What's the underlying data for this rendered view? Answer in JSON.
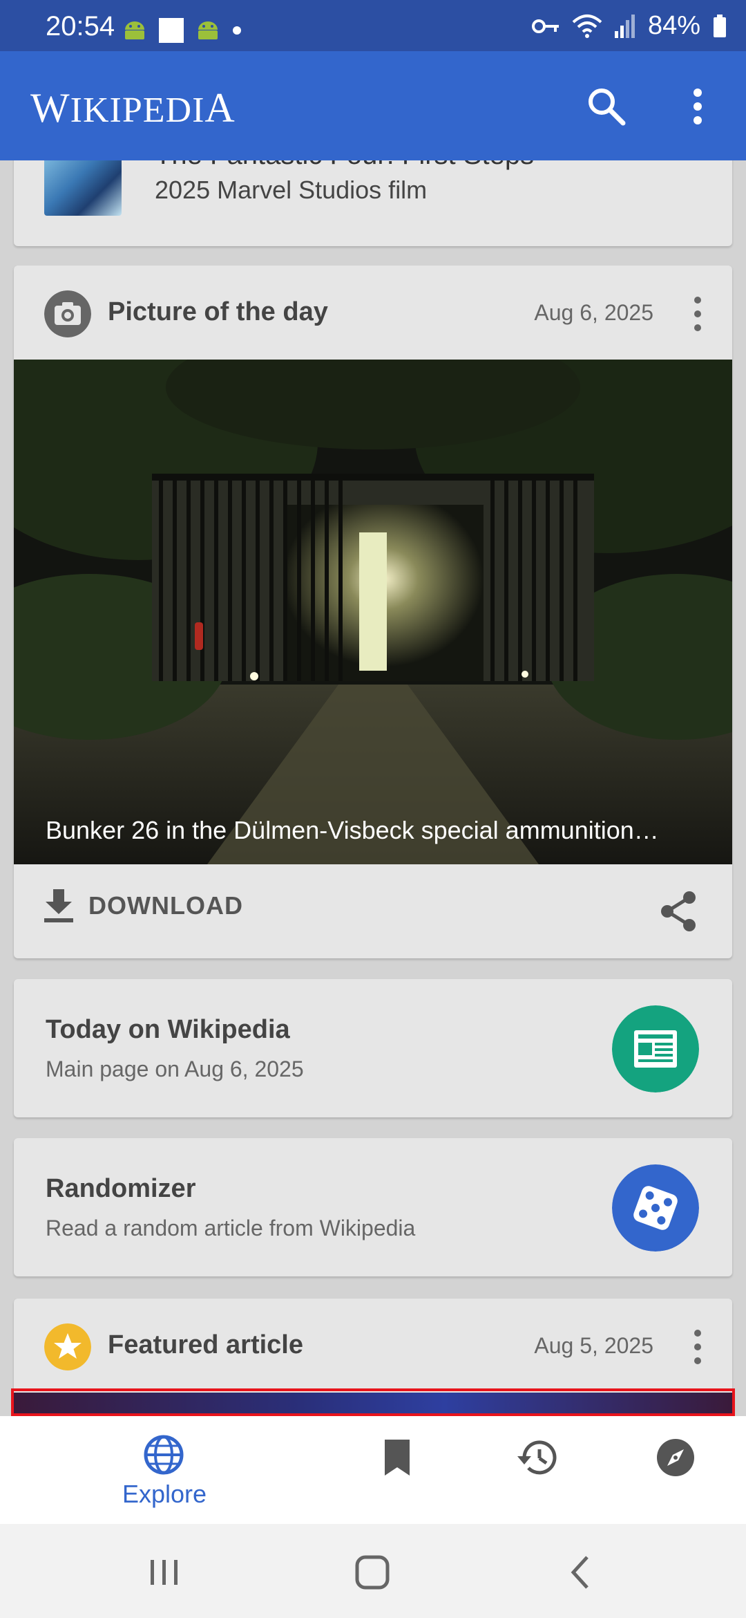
{
  "status_bar": {
    "time": "20:54",
    "battery": "84%",
    "icons_left": [
      "android-icon",
      "square-icon",
      "android-icon",
      "dot-icon"
    ],
    "icons_right": [
      "key-icon",
      "wifi-icon",
      "signal-icon",
      "battery-icon"
    ]
  },
  "app_bar": {
    "logo_w": "W",
    "logo_mid": "IKIPEDI",
    "logo_a": "A",
    "search_icon": "search-icon",
    "more_icon": "more-vert-icon",
    "colors": {
      "background": "#3366cc",
      "status": "#2c4fa3"
    }
  },
  "feed": {
    "previous_card": {
      "title": "The Fantastic Four: First Steps",
      "subtitle": "2025 Marvel Studios film"
    },
    "picture_of_the_day": {
      "header": "Picture of the day",
      "date": "Aug 6, 2025",
      "caption": "Bunker 26 in the Dülmen-Visbeck special ammunition…",
      "download_label": "DOWNLOAD",
      "icons": [
        "camera-icon",
        "download-icon",
        "share-icon"
      ]
    },
    "today": {
      "title": "Today on Wikipedia",
      "subtitle": "Main page on Aug 6, 2025",
      "icon": "newspaper-icon",
      "color": "#14a37f"
    },
    "randomizer": {
      "title": "Randomizer",
      "subtitle": "Read a random article from Wikipedia",
      "icon": "dice-icon",
      "color": "#3366cc"
    },
    "featured": {
      "header": "Featured article",
      "date": "Aug 5, 2025",
      "icon": "star-icon",
      "color": "#f2b92c"
    }
  },
  "bottom_nav": {
    "explore_label": "Explore",
    "items": [
      "explore-icon",
      "saved-icon",
      "history-icon",
      "nearby-icon"
    ],
    "active_color": "#3366cc"
  },
  "system_nav": [
    "recents-button",
    "home-button",
    "back-button"
  ]
}
